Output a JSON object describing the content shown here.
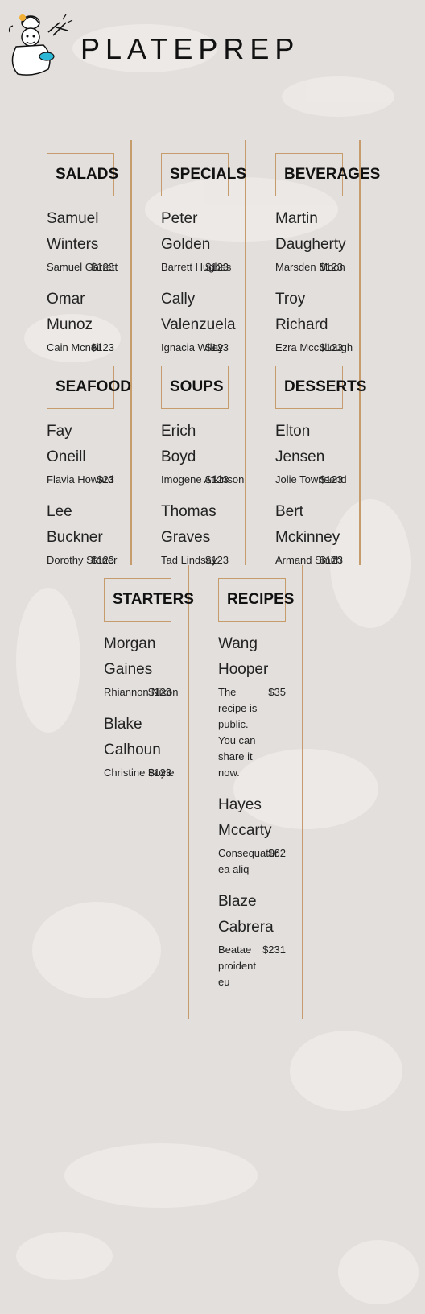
{
  "brand": {
    "name": "PLATEPREP"
  },
  "categories": [
    {
      "title": "SALADS",
      "items": [
        {
          "name": "Samuel Winters",
          "desc": "Samuel Garrett",
          "price": "$123"
        },
        {
          "name": "Omar Munoz",
          "desc": "Cain Mcneil",
          "price": "$123"
        }
      ]
    },
    {
      "title": "SPECIALS",
      "items": [
        {
          "name": "Peter Golden",
          "desc": "Barrett Hughes",
          "price": "$123"
        },
        {
          "name": "Cally Valenzuela",
          "desc": "Ignacia Wiley",
          "price": "$123"
        }
      ]
    },
    {
      "title": "BEVERAGES",
      "items": [
        {
          "name": "Martin Daugherty",
          "desc": "Marsden Moon",
          "price": "$123"
        },
        {
          "name": "Troy Richard",
          "desc": "Ezra Mccullough",
          "price": "$123"
        }
      ]
    },
    {
      "title": "SEAFOOD",
      "items": [
        {
          "name": "Fay Oneill",
          "desc": "Flavia Howard",
          "price": "$23"
        },
        {
          "name": "Lee Buckner",
          "desc": "Dorothy Stoner",
          "price": "$123"
        }
      ]
    },
    {
      "title": "SOUPS",
      "items": [
        {
          "name": "Erich Boyd",
          "desc": "Imogene Atkinson",
          "price": "$123"
        },
        {
          "name": "Thomas Graves",
          "desc": "Tad Lindsay",
          "price": "$123"
        }
      ]
    },
    {
      "title": "DESSERTS",
      "items": [
        {
          "name": "Elton Jensen",
          "desc": "Jolie Townsend",
          "price": "$123"
        },
        {
          "name": "Bert Mckinney",
          "desc": "Armand Smith",
          "price": "$123"
        }
      ]
    },
    {
      "title": "STARTERS",
      "items": [
        {
          "name": "Morgan Gaines",
          "desc": "Rhiannon Nixon",
          "price": "$123"
        },
        {
          "name": "Blake Calhoun",
          "desc": "Christine Boyle",
          "price": "$123"
        }
      ]
    },
    {
      "title": "RECIPES",
      "items": [
        {
          "name": "Wang Hooper",
          "desc": "The recipe is public. You can share it now.",
          "price": "$35"
        },
        {
          "name": "Hayes Mccarty",
          "desc": "Consequatur ea aliq",
          "price": "$62"
        },
        {
          "name": "Blaze Cabrera",
          "desc": "Beatae proident eu",
          "price": "$231"
        }
      ]
    }
  ]
}
